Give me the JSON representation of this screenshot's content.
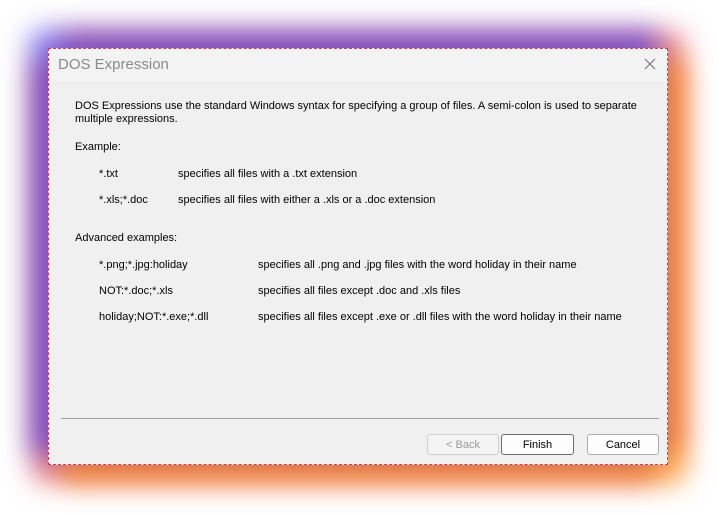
{
  "window": {
    "title": "DOS Expression"
  },
  "content": {
    "intro": "DOS Expressions use the standard Windows syntax for specifying a group of files. A semi-colon is used to separate multiple expressions.",
    "example_heading": "Example:",
    "examples": [
      {
        "pattern": "*.txt",
        "description": "specifies all files with a .txt extension"
      },
      {
        "pattern": "*.xls;*.doc",
        "description": "specifies all files with either a .xls or a .doc extension"
      }
    ],
    "advanced_heading": "Advanced examples:",
    "advanced_examples": [
      {
        "pattern": "*.png;*.jpg:holiday",
        "description": "specifies all .png and .jpg files with the word holiday in their name"
      },
      {
        "pattern": "NOT:*.doc;*.xls",
        "description": "specifies all files except .doc and .xls files"
      },
      {
        "pattern": "holiday;NOT:*.exe;*.dll",
        "description": "specifies all files except .exe or .dll files with the word holiday in their name"
      }
    ]
  },
  "buttons": {
    "back": "< Back",
    "finish": "Finish",
    "cancel": "Cancel"
  },
  "colors": {
    "dialog_background": "#f0f0f0",
    "title_text": "#8a8a8a",
    "disabled_text": "#9a9a9a",
    "glow_left": "#4637e6",
    "glow_right": "#ff8c14"
  }
}
